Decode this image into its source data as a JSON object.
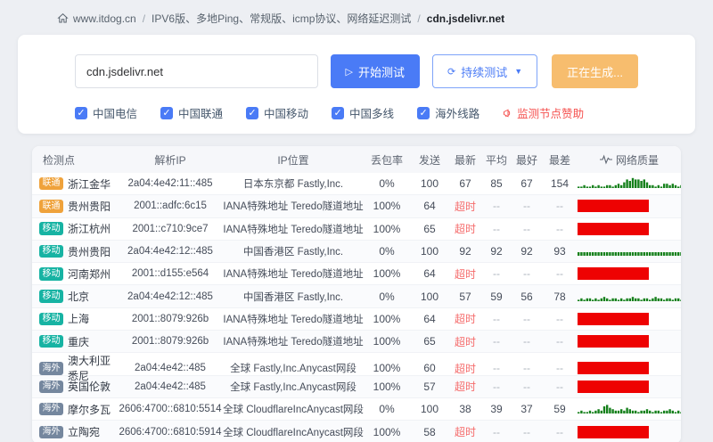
{
  "breadcrumb": {
    "home": "www.itdog.cn",
    "separator": "/",
    "category": "IPV6版、多地Ping、常规版、icmp协议、网络延迟测试",
    "current": "cdn.jsdelivr.net"
  },
  "search": {
    "value": "cdn.jsdelivr.net",
    "start_button": "开始测试",
    "continuous_button": "持续测试",
    "generating_button": "正在生成..."
  },
  "filters": {
    "options": [
      {
        "label": "中国电信",
        "checked": true
      },
      {
        "label": "中国联通",
        "checked": true
      },
      {
        "label": "中国移动",
        "checked": true
      },
      {
        "label": "中国多线",
        "checked": true
      },
      {
        "label": "海外线路",
        "checked": true
      }
    ],
    "sponsor_link": "监测节点赞助"
  },
  "table": {
    "headers": [
      "检测点",
      "解析IP",
      "IP位置",
      "丢包率",
      "发送",
      "最新",
      "平均",
      "最好",
      "最差",
      "网络质量"
    ],
    "rows": [
      {
        "isp": "联通",
        "badge_color": "#efa23b",
        "node": "浙江金华",
        "ip": "2a04:4e42:11::485",
        "location": "日本东京都 Fastly,Inc.",
        "loss": "0%",
        "sent": "100",
        "latest": "67",
        "avg": "85",
        "best": "67",
        "worst": "154",
        "timeout": false,
        "quality": {
          "type": "spark",
          "values": [
            1,
            1,
            2,
            1,
            1,
            2,
            1,
            2,
            1,
            1,
            2,
            2,
            1,
            2,
            3,
            2,
            4,
            6,
            5,
            7,
            6,
            6,
            5,
            6,
            4,
            2,
            2,
            1,
            2,
            1,
            3,
            3,
            2,
            3,
            2,
            1,
            2,
            1,
            1,
            1
          ]
        }
      },
      {
        "isp": "联通",
        "badge_color": "#efa23b",
        "node": "贵州贵阳",
        "ip": "2001::adfc:6c15",
        "location": "IANA特殊地址 Teredo隧道地址",
        "loss": "100%",
        "sent": "64",
        "latest": "超时",
        "avg": "--",
        "best": "--",
        "worst": "--",
        "timeout": true,
        "quality": {
          "type": "block"
        }
      },
      {
        "isp": "移动",
        "badge_color": "#17b3a3",
        "node": "浙江杭州",
        "ip": "2001::c710:9ce7",
        "location": "IANA特殊地址 Teredo隧道地址",
        "loss": "100%",
        "sent": "65",
        "latest": "超时",
        "avg": "--",
        "best": "--",
        "worst": "--",
        "timeout": true,
        "quality": {
          "type": "block"
        }
      },
      {
        "isp": "移动",
        "badge_color": "#17b3a3",
        "node": "贵州贵阳",
        "ip": "2a04:4e42:12::485",
        "location": "中国香港区 Fastly,Inc.",
        "loss": "0%",
        "sent": "100",
        "latest": "92",
        "avg": "92",
        "best": "92",
        "worst": "93",
        "timeout": false,
        "quality": {
          "type": "spark",
          "values": [
            2.5,
            2.5,
            2.5,
            2.5,
            2.5,
            2.5,
            2.5,
            2.5,
            2.5,
            2.5,
            2.5,
            2.5,
            2.5,
            2.5,
            2.5,
            2.5,
            2.5,
            2.5,
            2.5,
            2.5,
            2.5,
            2.5,
            2.5,
            2.5,
            2.5,
            2.5,
            2.5,
            2.5,
            2.5,
            2.5,
            2.5,
            2.5,
            2.5,
            2.5,
            2.5,
            2.5,
            2.5,
            2.5,
            2.5,
            2.5
          ]
        }
      },
      {
        "isp": "移动",
        "badge_color": "#17b3a3",
        "node": "河南郑州",
        "ip": "2001::d155:e564",
        "location": "IANA特殊地址 Teredo隧道地址",
        "loss": "100%",
        "sent": "64",
        "latest": "超时",
        "avg": "--",
        "best": "--",
        "worst": "--",
        "timeout": true,
        "quality": {
          "type": "block"
        }
      },
      {
        "isp": "移动",
        "badge_color": "#17b3a3",
        "node": "北京",
        "ip": "2a04:4e42:12::485",
        "location": "中国香港区 Fastly,Inc.",
        "loss": "0%",
        "sent": "100",
        "latest": "57",
        "avg": "59",
        "best": "56",
        "worst": "78",
        "timeout": false,
        "quality": {
          "type": "spark",
          "values": [
            1,
            2,
            1,
            2,
            2,
            1,
            2,
            1,
            2,
            3,
            2,
            1,
            2,
            2,
            1,
            2,
            1,
            2,
            2,
            3,
            2,
            2,
            1,
            2,
            2,
            1,
            2,
            3,
            2,
            2,
            1,
            2,
            2,
            1,
            2,
            2,
            1,
            2,
            1,
            2
          ]
        }
      },
      {
        "isp": "移动",
        "badge_color": "#17b3a3",
        "node": "上海",
        "ip": "2001::8079:926b",
        "location": "IANA特殊地址 Teredo隧道地址",
        "loss": "100%",
        "sent": "64",
        "latest": "超时",
        "avg": "--",
        "best": "--",
        "worst": "--",
        "timeout": true,
        "quality": {
          "type": "block"
        }
      },
      {
        "isp": "移动",
        "badge_color": "#17b3a3",
        "node": "重庆",
        "ip": "2001::8079:926b",
        "location": "IANA特殊地址 Teredo隧道地址",
        "loss": "100%",
        "sent": "65",
        "latest": "超时",
        "avg": "--",
        "best": "--",
        "worst": "--",
        "timeout": true,
        "quality": {
          "type": "block"
        }
      },
      {
        "isp": "海外",
        "badge_color": "#75879e",
        "node": "澳大利亚悉尼",
        "ip": "2a04:4e42::485",
        "location": "全球 Fastly,Inc.Anycast网段",
        "loss": "100%",
        "sent": "60",
        "latest": "超时",
        "avg": "--",
        "best": "--",
        "worst": "--",
        "timeout": true,
        "quality": {
          "type": "block"
        }
      },
      {
        "isp": "海外",
        "badge_color": "#75879e",
        "node": "英国伦敦",
        "ip": "2a04:4e42::485",
        "location": "全球 Fastly,Inc.Anycast网段",
        "loss": "100%",
        "sent": "57",
        "latest": "超时",
        "avg": "--",
        "best": "--",
        "worst": "--",
        "timeout": true,
        "quality": {
          "type": "block"
        }
      },
      {
        "isp": "海外",
        "badge_color": "#75879e",
        "node": "摩尔多瓦",
        "ip": "2606:4700::6810:5514",
        "location": "全球 CloudflareIncAnycast网段",
        "loss": "0%",
        "sent": "100",
        "latest": "38",
        "avg": "39",
        "best": "37",
        "worst": "59",
        "timeout": false,
        "quality": {
          "type": "spark",
          "values": [
            1,
            2,
            1,
            1,
            2,
            1,
            2,
            3,
            2,
            5,
            6,
            4,
            3,
            2,
            2,
            3,
            2,
            4,
            3,
            2,
            2,
            1,
            2,
            2,
            3,
            2,
            1,
            2,
            2,
            1,
            2,
            2,
            3,
            2,
            1,
            2,
            1,
            2,
            2,
            1
          ]
        }
      },
      {
        "isp": "海外",
        "badge_color": "#75879e",
        "node": "立陶宛",
        "ip": "2606:4700::6810:5914",
        "location": "全球 CloudflareIncAnycast网段",
        "loss": "100%",
        "sent": "58",
        "latest": "超时",
        "avg": "--",
        "best": "--",
        "worst": "--",
        "timeout": true,
        "quality": {
          "type": "block"
        }
      }
    ]
  },
  "colors": {
    "primary_blue": "#4a7bf6",
    "warning_orange": "#f7bd6e",
    "danger_red": "#f56c6c",
    "bar_red": "#ee0202",
    "spark_green": "#15801b"
  }
}
